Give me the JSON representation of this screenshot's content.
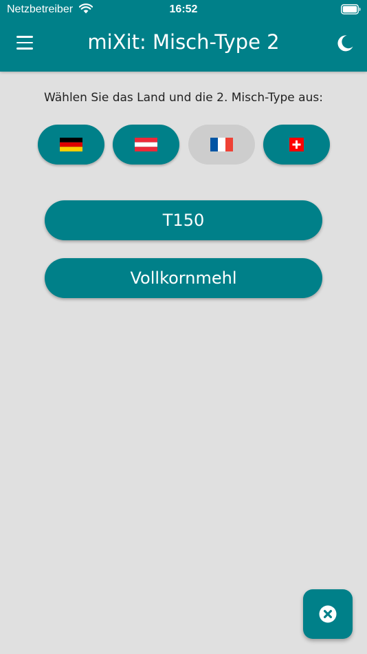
{
  "status_bar": {
    "carrier": "Netzbetreiber",
    "time": "16:52"
  },
  "header": {
    "title": "miXit: Misch-Type 2",
    "menu_icon": "menu-icon",
    "theme_icon": "moon-icon"
  },
  "content": {
    "instruction": "Wählen Sie das Land und die 2. Misch-Type aus:",
    "countries": [
      {
        "code": "de",
        "icon": "flag-germany-icon",
        "selected": true
      },
      {
        "code": "at",
        "icon": "flag-austria-icon",
        "selected": true
      },
      {
        "code": "fr",
        "icon": "flag-france-icon",
        "selected": false
      },
      {
        "code": "ch",
        "icon": "flag-switzerland-icon",
        "selected": true
      }
    ],
    "choices": [
      {
        "label": "T150"
      },
      {
        "label": "Vollkornmehl"
      }
    ]
  },
  "fab": {
    "icon": "close-circle-icon"
  },
  "colors": {
    "primary": "#008089",
    "background": "#e0e0e0",
    "inactive": "#cdcdcd"
  }
}
